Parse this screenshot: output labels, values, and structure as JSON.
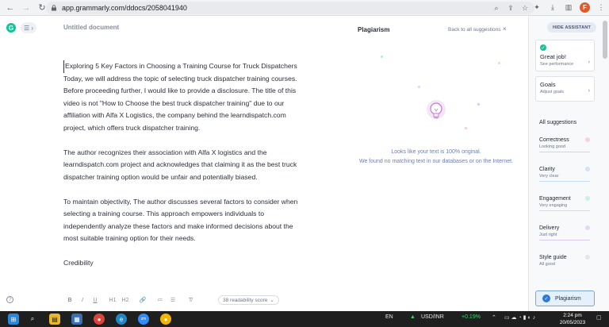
{
  "browser": {
    "url": "app.grammarly.com/ddocs/2058041940",
    "profile_initial": "F"
  },
  "editor": {
    "doc_title": "Untitled document",
    "paragraphs": [
      "Exploring 5 Key Factors in Choosing a Training Course for Truck Dispatchers",
      "Today, we will address the topic of selecting truck dispatcher training courses. Before proceeding further, I would like to provide a disclosure. The title of this video is not \"How to Choose the best truck dispatcher training\" due to our affiliation with Alfa X Logistics, the company behind the learndispatch.com project, which offers truck dispatcher training.",
      "The author recognizes their association with Alfa X logistics and the learndispatch.com project and acknowledges that claiming it as the best truck dispatcher training option would be unfair and potentially biased.",
      "To maintain objectivity, The author discusses several factors to consider when selecting a training course. This approach empowers individuals to independently analyze these factors and make informed decisions about the most suitable training option for their needs.",
      " Credibility"
    ],
    "toolbar": {
      "bold": "B",
      "italic": "I",
      "underline": "U",
      "h1": "H1",
      "h2": "H2",
      "link": "🔗",
      "ordered_list": "≔",
      "bullet_list": "☰",
      "clear_format": "T̸",
      "readability": "38 readability score"
    }
  },
  "plagiarism_panel": {
    "title": "Plagiarism",
    "back_link": "Back to all suggestions",
    "close": "×",
    "message_line1": "Looks like your text is 100% original.",
    "message_line2": "We found no matching text in our databases or on the Internet."
  },
  "sidebar": {
    "hide_assistant": "HIDE ASSISTANT",
    "great_job": {
      "title": "Great job!",
      "sub": "See performance"
    },
    "goals": {
      "title": "Goals",
      "sub": "Adjust goals"
    },
    "all_suggestions": "All suggestions",
    "metrics": [
      {
        "name": "Correctness",
        "value": "Looking good",
        "color": "#e86b7c"
      },
      {
        "name": "Clarity",
        "value": "Very clear",
        "color": "#4a90e2"
      },
      {
        "name": "Engagement",
        "value": "Very engaging",
        "color": "#15c39a"
      },
      {
        "name": "Delivery",
        "value": "Just right",
        "color": "#9b6dd6"
      },
      {
        "name": "Style guide",
        "value": "All good",
        "color": "#c7c9d1"
      }
    ],
    "plagiarism_button": "Plagiarism"
  },
  "taskbar": {
    "language": "EN",
    "ticker_label": "USD/INR",
    "ticker_change": "+0.19%",
    "time": "2:24 pm",
    "date": "20/05/2023"
  },
  "colors": {
    "accent": "#15c39a",
    "plagiarism_blue": "#2e79d6",
    "ticker_green": "#3fd36b"
  }
}
